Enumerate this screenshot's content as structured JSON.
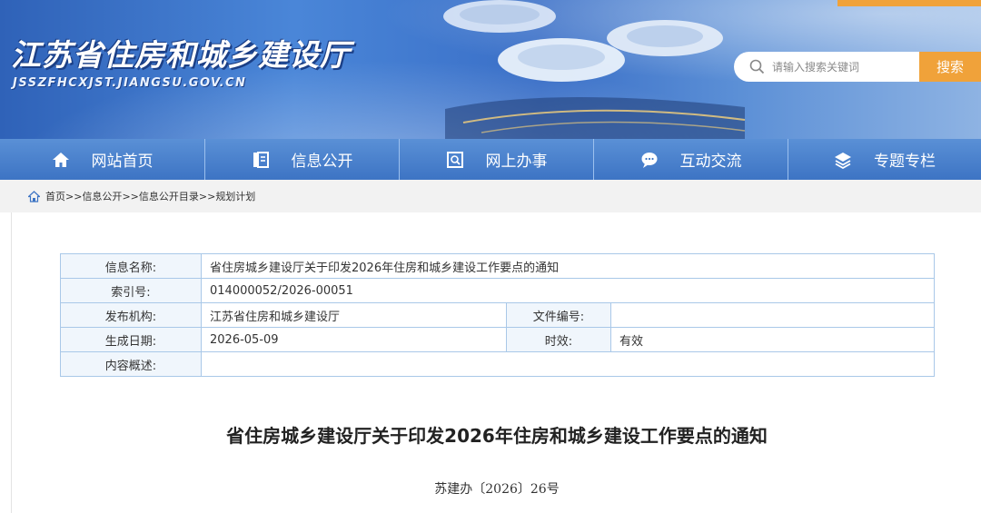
{
  "site": {
    "title": "江苏省住房和城乡建设厅",
    "domain": "JSSZFHCXJST.JIANGSU.GOV.CN",
    "accent": "#f0a23a",
    "nav_blue": "#3d74c4"
  },
  "search": {
    "placeholder": "请输入搜索关键词",
    "button_label": "搜索",
    "icon": "search-icon"
  },
  "nav": {
    "items": [
      {
        "label": "网站首页",
        "icon": "home-icon"
      },
      {
        "label": "信息公开",
        "icon": "document-list-icon"
      },
      {
        "label": "网上办事",
        "icon": "service-search-icon"
      },
      {
        "label": "互动交流",
        "icon": "chat-bubble-icon"
      },
      {
        "label": "专题专栏",
        "icon": "layers-icon"
      }
    ]
  },
  "breadcrumb": {
    "icon": "home-icon",
    "items": [
      "首页",
      "信息公开",
      "信息公开目录",
      "规划计划"
    ],
    "separator": ">>"
  },
  "info": {
    "name_label": "信息名称:",
    "name_value": "省住房城乡建设厅关于印发2026年住房和城乡建设工作要点的通知",
    "index_label": "索引号:",
    "index_value": "014000052/2026-00051",
    "publisher_label": "发布机构:",
    "publisher_value": "江苏省住房和城乡建设厅",
    "docno_label": "文件编号:",
    "docno_value": "",
    "date_label": "生成日期:",
    "date_value": "2026-05-09",
    "validity_label": "时效:",
    "validity_value": "有效",
    "summary_label": "内容概述:",
    "summary_value": ""
  },
  "document": {
    "title": "省住房城乡建设厅关于印发2026年住房和城乡建设工作要点的通知",
    "number": "苏建办〔2026〕26号"
  }
}
